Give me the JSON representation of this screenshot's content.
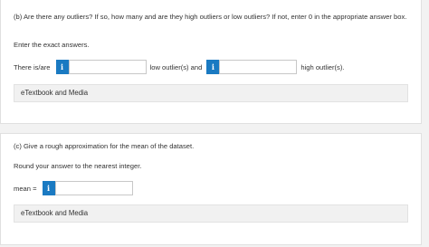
{
  "part_b": {
    "question": "(b) Are there any outliers? If so, how many and are they high outliers or low outliers? If not, enter 0 in the appropriate answer box.",
    "instruction": "Enter the exact answers.",
    "prefix": "There is/are",
    "middle": "low outlier(s) and",
    "suffix": "high outlier(s).",
    "low_value": "",
    "high_value": "",
    "etextbook": "eTextbook and Media"
  },
  "part_c": {
    "question": "(c) Give a rough approximation for the mean of the dataset.",
    "instruction": "Round your answer to the nearest integer.",
    "label": "mean =",
    "mean_value": "",
    "etextbook": "eTextbook and Media"
  },
  "info_glyph": "i",
  "colors": {
    "info_button": "#1a7ac2",
    "background": "#f2f2f2"
  }
}
